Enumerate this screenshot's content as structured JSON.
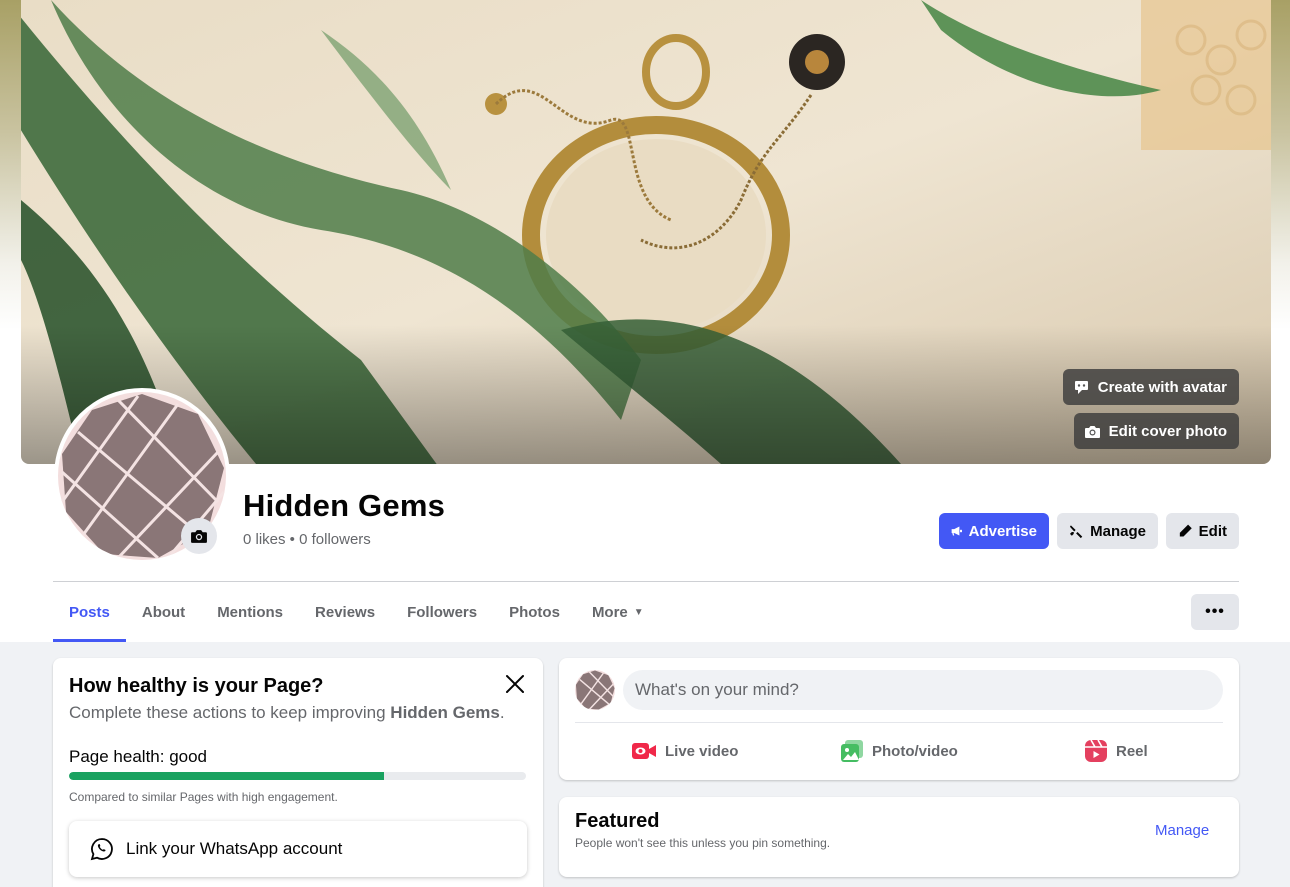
{
  "cover": {
    "create_avatar_label": "Create with avatar",
    "edit_cover_label": "Edit cover photo"
  },
  "profile": {
    "name": "Hidden Gems",
    "stats": "0 likes • 0 followers"
  },
  "actions": {
    "advertise": "Advertise",
    "manage": "Manage",
    "edit": "Edit"
  },
  "tabs": [
    {
      "label": "Posts",
      "active": true
    },
    {
      "label": "About"
    },
    {
      "label": "Mentions"
    },
    {
      "label": "Reviews"
    },
    {
      "label": "Followers"
    },
    {
      "label": "Photos"
    },
    {
      "label": "More"
    }
  ],
  "more_menu": "•••",
  "health": {
    "title": "How healthy is your Page?",
    "subtitle_prefix": "Complete these actions to keep improving ",
    "subtitle_name": "Hidden Gems",
    "subtitle_suffix": ".",
    "status_label": "Page health: good",
    "progress": 0.69,
    "note": "Compared to similar Pages with high engagement.",
    "whatsapp_label": "Link your WhatsApp account"
  },
  "composer": {
    "placeholder": "What's on your mind?",
    "live_video": "Live video",
    "photo_video": "Photo/video",
    "reel": "Reel"
  },
  "featured": {
    "title": "Featured",
    "subtitle": "People won't see this unless you pin something.",
    "manage": "Manage"
  },
  "colors": {
    "accent": "#4358f5",
    "health_fill": "#1aa260",
    "live_icon": "#f02849",
    "photo_icon": "#45bd62",
    "reel_icon": "#e4405f",
    "avatar_fill": "#8a7677"
  }
}
